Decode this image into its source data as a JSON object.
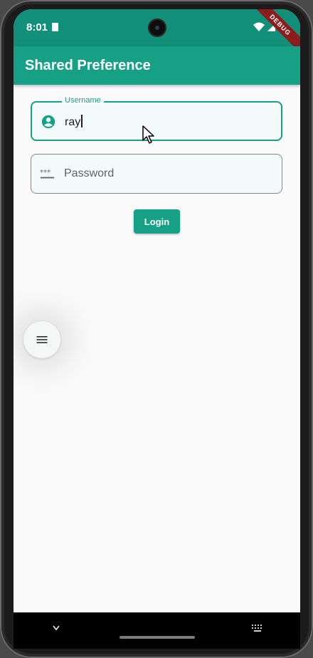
{
  "status_bar": {
    "time": "8:01",
    "debug_banner": "DEBUG"
  },
  "app_bar": {
    "title": "Shared Preference"
  },
  "form": {
    "username": {
      "label": "Username",
      "value": "ray",
      "focused": true
    },
    "password": {
      "placeholder": "Password",
      "value": ""
    },
    "login_label": "Login"
  },
  "icons": {
    "username": "account-circle-icon",
    "password": "password-dots-icon",
    "menu": "menu-icon",
    "nav_back": "chevron-down-icon",
    "keyboard": "keyboard-icon"
  },
  "colors": {
    "primary": "#16a086",
    "status_bar": "#128f78",
    "background": "#fafafa"
  }
}
